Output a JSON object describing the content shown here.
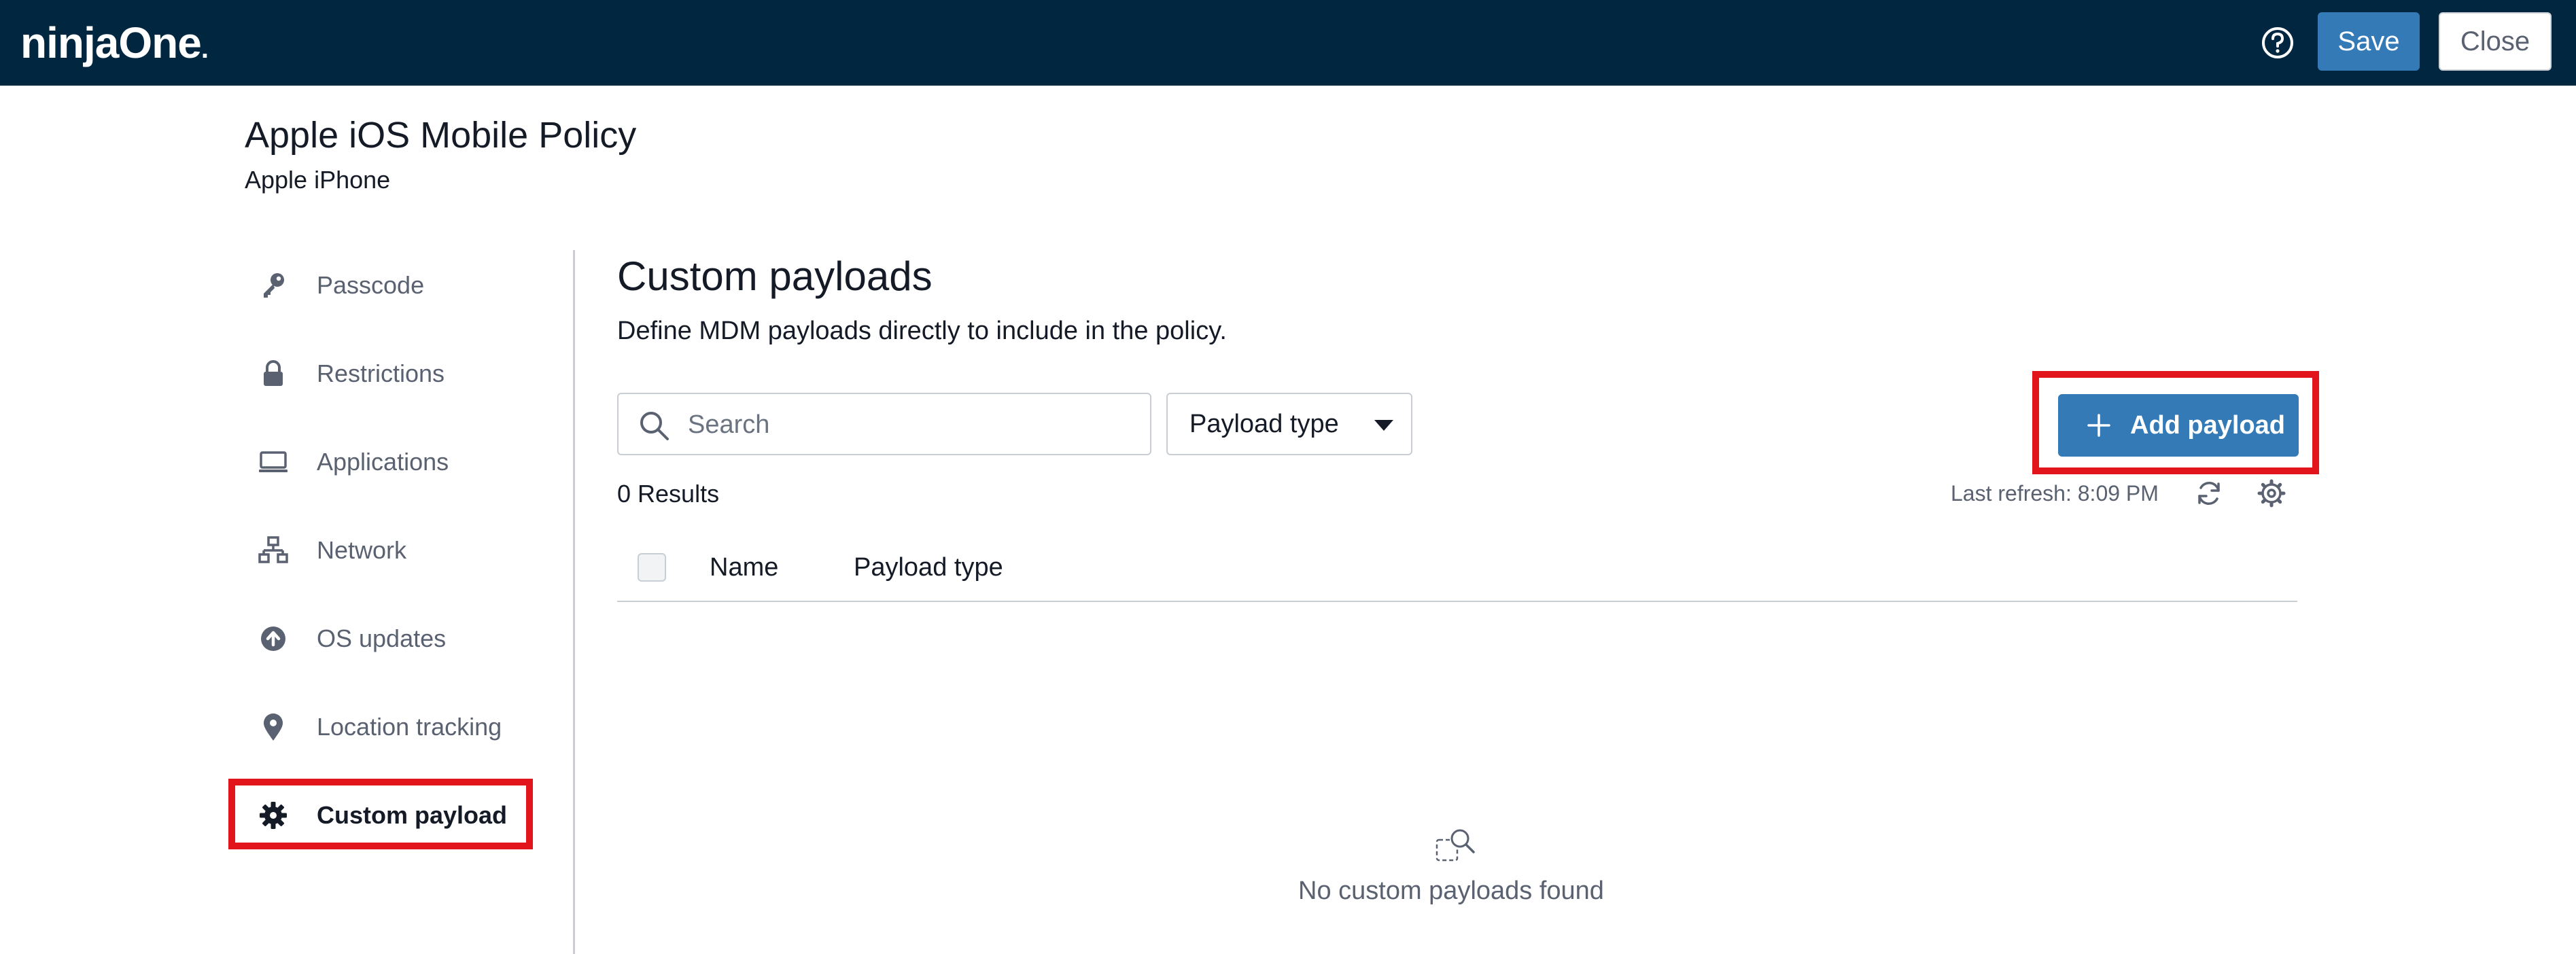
{
  "app": {
    "logo": "ninjaOne",
    "logo_dot": ".",
    "save_label": "Save",
    "close_label": "Close"
  },
  "policy": {
    "title": "Apple iOS Mobile Policy",
    "subtitle": "Apple iPhone"
  },
  "sidebar": {
    "items": [
      {
        "label": "Passcode",
        "icon": "key-icon"
      },
      {
        "label": "Restrictions",
        "icon": "lock-icon"
      },
      {
        "label": "Applications",
        "icon": "monitor-icon"
      },
      {
        "label": "Network",
        "icon": "network-icon"
      },
      {
        "label": "OS updates",
        "icon": "upload-circle-icon"
      },
      {
        "label": "Location tracking",
        "icon": "map-pin-icon"
      },
      {
        "label": "Custom payload",
        "icon": "gear-icon",
        "active": true
      }
    ]
  },
  "main": {
    "title": "Custom payloads",
    "description": "Define MDM payloads directly to include in the policy.",
    "search_placeholder": "Search",
    "payload_type_label": "Payload type",
    "add_payload_label": "Add payload",
    "results_label": "0 Results",
    "last_refresh": "Last refresh: 8:09 PM",
    "columns": [
      "Name",
      "Payload type"
    ],
    "empty_message": "No custom payloads found"
  },
  "colors": {
    "topbar": "#002640",
    "primary": "#337ab7",
    "highlight": "#e3151c",
    "muted_text": "#5a6170"
  }
}
